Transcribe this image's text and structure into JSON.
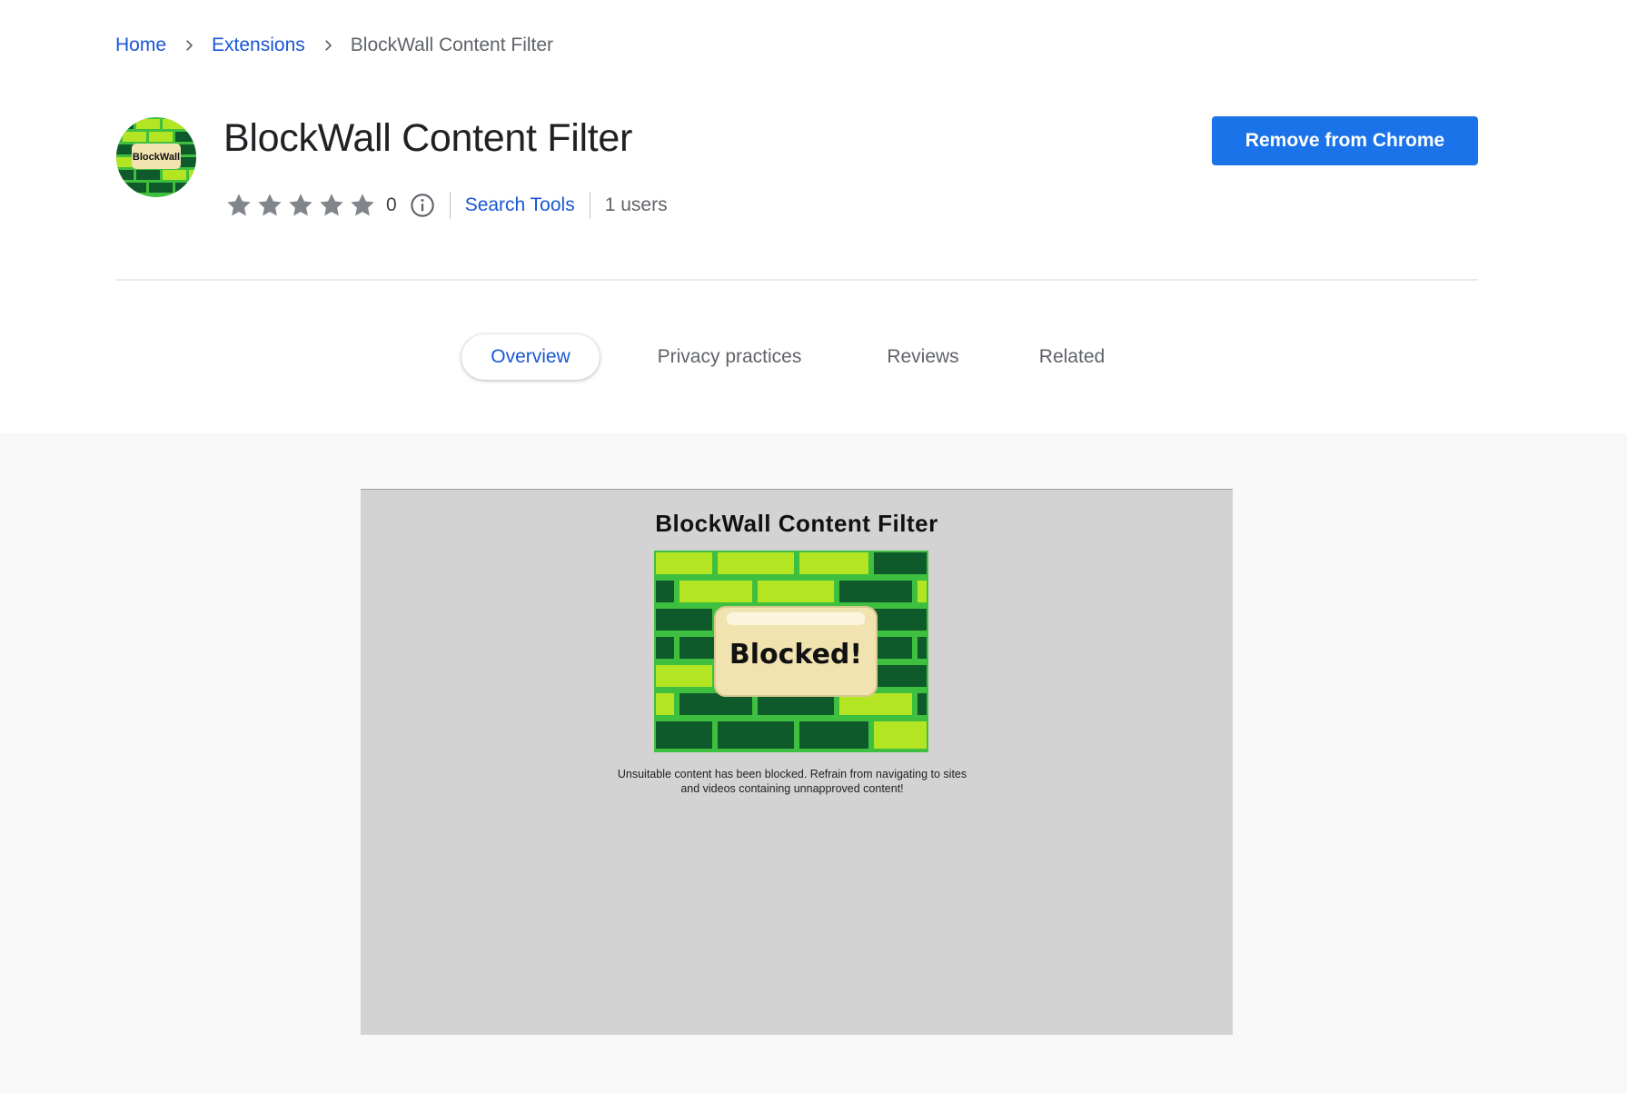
{
  "breadcrumb": {
    "home": "Home",
    "extensions": "Extensions",
    "current": "BlockWall Content Filter"
  },
  "extension": {
    "icon_label": "BlockWall",
    "title": "BlockWall Content Filter",
    "rating_count": "0",
    "stars_filled": 0,
    "category": "Search Tools",
    "users": "1 users",
    "action_button": "Remove from Chrome"
  },
  "tabs": [
    {
      "label": "Overview",
      "active": true
    },
    {
      "label": "Privacy practices",
      "active": false
    },
    {
      "label": "Reviews",
      "active": false
    },
    {
      "label": "Related",
      "active": false
    }
  ],
  "screenshot": {
    "title": "BlockWall Content Filter",
    "badge": "Blocked!",
    "caption": "Unsuitable content has been blocked. Refrain from navigating to sites and videos containing unnapproved content!"
  },
  "colors": {
    "link": "#1a56d6",
    "primary_button": "#1a73e8",
    "brick_light": "#b3e522",
    "brick_dark": "#0f5a2a",
    "mortar": "#3fbf3f",
    "badge_bg": "#f1e3b0"
  }
}
